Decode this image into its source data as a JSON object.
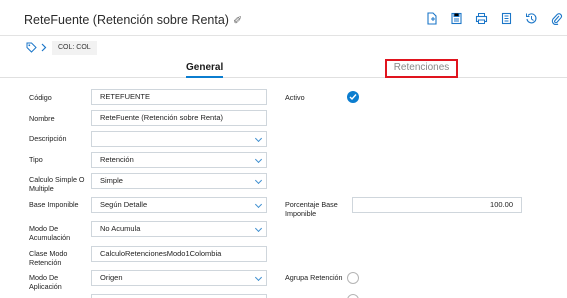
{
  "header": {
    "title": "ReteFuente (Retención sobre Renta)",
    "toolbar_icons": [
      "new-document-icon",
      "save-icon",
      "print-icon",
      "list-icon",
      "history-icon",
      "attachment-icon",
      "more-icon"
    ]
  },
  "breadcrumb": {
    "company": "COL: COL"
  },
  "tabs": {
    "general": "General",
    "retenciones": "Retenciones"
  },
  "form": {
    "codigo": {
      "label": "Código",
      "value": "RETEFUENTE"
    },
    "nombre": {
      "label": "Nombre",
      "value": "ReteFuente (Retención sobre Renta)"
    },
    "descripcion": {
      "label": "Descripción",
      "value": ""
    },
    "tipo": {
      "label": "Tipo",
      "value": "Retención"
    },
    "calculo": {
      "label": "Calculo Simple O Multiple",
      "value": "Simple"
    },
    "base_imponible": {
      "label": "Base Imponible",
      "value": "Según Detalle"
    },
    "modo_acumulacion": {
      "label": "Modo De Acumulación",
      "value": "No Acumula"
    },
    "clase_modo_retencion": {
      "label": "Clase Modo Retención",
      "value": "CalculoRetencionesModo1Colombia"
    },
    "modo_aplicacion": {
      "label": "Modo De Aplicación",
      "value": "Origen"
    },
    "activo": {
      "label": "Activo",
      "checked": true
    },
    "porcentaje_base": {
      "label": "Porcentaje Base Imponible",
      "value": "100.00"
    },
    "agrupa_retencion": {
      "label": "Agrupa Retención",
      "checked": false
    }
  },
  "colors": {
    "accent": "#0b7dcf",
    "highlight": "#e0141e"
  }
}
